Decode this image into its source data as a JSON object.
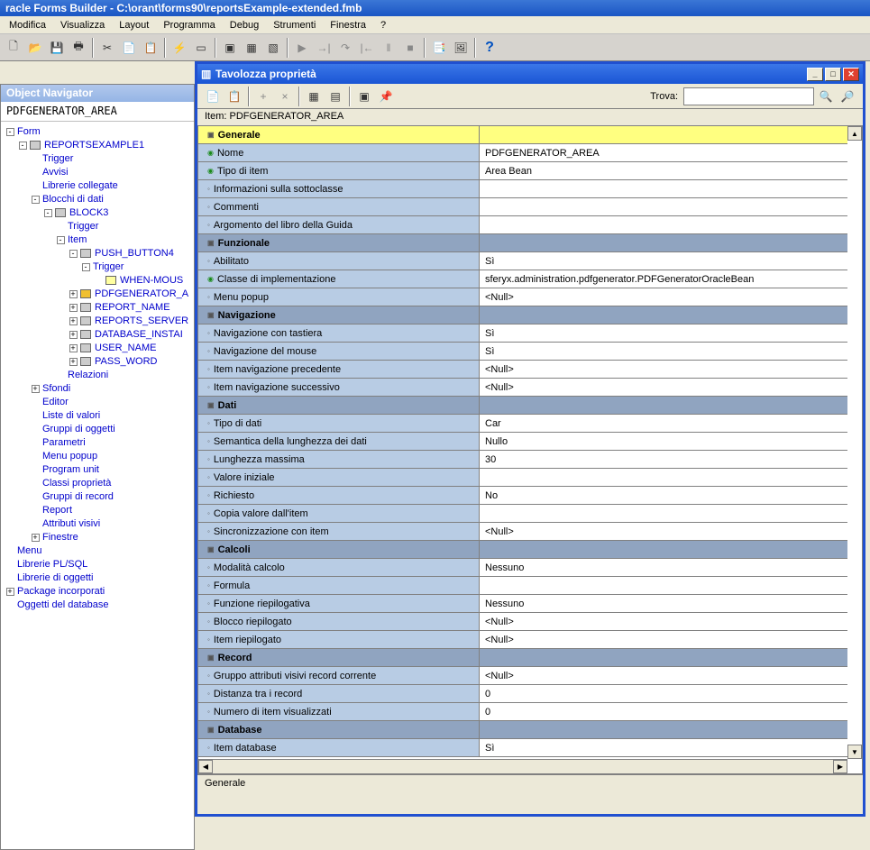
{
  "app_title": "racle Forms Builder - C:\\orant\\forms90\\reportsExample-extended.fmb",
  "menu": [
    "Modifica",
    "Visualizza",
    "Layout",
    "Programma",
    "Debug",
    "Strumenti",
    "Finestra",
    "?"
  ],
  "obj_nav": {
    "title": "Object Navigator",
    "current": "PDFGENERATOR_AREA",
    "tree": [
      {
        "indent": 0,
        "exp": "−",
        "glyph": "",
        "text": "Form"
      },
      {
        "indent": 1,
        "exp": "−",
        "glyph": "form",
        "text": "REPORTSEXAMPLE1"
      },
      {
        "indent": 2,
        "exp": "",
        "glyph": "",
        "text": "Trigger"
      },
      {
        "indent": 2,
        "exp": "",
        "glyph": "",
        "text": "Avvisi"
      },
      {
        "indent": 2,
        "exp": "",
        "glyph": "",
        "text": "Librerie collegate"
      },
      {
        "indent": 2,
        "exp": "−",
        "glyph": "",
        "text": "Blocchi di dati"
      },
      {
        "indent": 3,
        "exp": "−",
        "glyph": "block",
        "text": "BLOCK3"
      },
      {
        "indent": 4,
        "exp": "",
        "glyph": "",
        "text": "Trigger"
      },
      {
        "indent": 4,
        "exp": "−",
        "glyph": "",
        "text": "Item"
      },
      {
        "indent": 5,
        "exp": "−",
        "glyph": "item",
        "text": "PUSH_BUTTON4"
      },
      {
        "indent": 6,
        "exp": "−",
        "glyph": "",
        "text": "Trigger"
      },
      {
        "indent": 7,
        "exp": "",
        "glyph": "trig",
        "text": "WHEN-MOUS"
      },
      {
        "indent": 5,
        "exp": "+",
        "glyph": "sel",
        "text": "PDFGENERATOR_A"
      },
      {
        "indent": 5,
        "exp": "+",
        "glyph": "item",
        "text": "REPORT_NAME"
      },
      {
        "indent": 5,
        "exp": "+",
        "glyph": "item",
        "text": "REPORTS_SERVER"
      },
      {
        "indent": 5,
        "exp": "+",
        "glyph": "item",
        "text": "DATABASE_INSTAI"
      },
      {
        "indent": 5,
        "exp": "+",
        "glyph": "item",
        "text": "USER_NAME"
      },
      {
        "indent": 5,
        "exp": "+",
        "glyph": "item",
        "text": "PASS_WORD"
      },
      {
        "indent": 4,
        "exp": "",
        "glyph": "",
        "text": "Relazioni"
      },
      {
        "indent": 2,
        "exp": "+",
        "glyph": "",
        "text": "Sfondi"
      },
      {
        "indent": 2,
        "exp": "",
        "glyph": "",
        "text": "Editor"
      },
      {
        "indent": 2,
        "exp": "",
        "glyph": "",
        "text": "Liste di valori"
      },
      {
        "indent": 2,
        "exp": "",
        "glyph": "",
        "text": "Gruppi di oggetti"
      },
      {
        "indent": 2,
        "exp": "",
        "glyph": "",
        "text": "Parametri"
      },
      {
        "indent": 2,
        "exp": "",
        "glyph": "",
        "text": "Menu popup"
      },
      {
        "indent": 2,
        "exp": "",
        "glyph": "",
        "text": "Program unit"
      },
      {
        "indent": 2,
        "exp": "",
        "glyph": "",
        "text": "Classi proprietà"
      },
      {
        "indent": 2,
        "exp": "",
        "glyph": "",
        "text": "Gruppi di record"
      },
      {
        "indent": 2,
        "exp": "",
        "glyph": "",
        "text": "Report"
      },
      {
        "indent": 2,
        "exp": "",
        "glyph": "",
        "text": "Attributi visivi"
      },
      {
        "indent": 2,
        "exp": "+",
        "glyph": "",
        "text": "Finestre"
      },
      {
        "indent": 0,
        "exp": "",
        "glyph": "",
        "text": "Menu"
      },
      {
        "indent": 0,
        "exp": "",
        "glyph": "",
        "text": "Librerie PL/SQL"
      },
      {
        "indent": 0,
        "exp": "",
        "glyph": "",
        "text": "Librerie di oggetti"
      },
      {
        "indent": 0,
        "exp": "+",
        "glyph": "",
        "text": "Package incorporati"
      },
      {
        "indent": 0,
        "exp": "",
        "glyph": "",
        "text": "Oggetti del database"
      }
    ]
  },
  "prop": {
    "title": "Tavolozza proprietà",
    "find_label": "Trova:",
    "find_value": "",
    "item_label": "Item: PDFGENERATOR_AREA",
    "status": "Generale",
    "rows": [
      {
        "type": "section-yellow",
        "name": "Generale"
      },
      {
        "type": "prop",
        "changed": true,
        "name": "Nome",
        "value": "PDFGENERATOR_AREA"
      },
      {
        "type": "prop",
        "changed": true,
        "name": "Tipo di item",
        "value": "Area Bean"
      },
      {
        "type": "prop",
        "name": "Informazioni sulla sottoclasse",
        "value": ""
      },
      {
        "type": "prop",
        "name": "Commenti",
        "value": ""
      },
      {
        "type": "prop",
        "name": "Argomento del libro della Guida",
        "value": ""
      },
      {
        "type": "section",
        "name": "Funzionale"
      },
      {
        "type": "prop",
        "name": "Abilitato",
        "value": "Sì"
      },
      {
        "type": "prop",
        "changed": true,
        "name": "Classe di implementazione",
        "value": "sferyx.administration.pdfgenerator.PDFGeneratorOracleBean"
      },
      {
        "type": "prop",
        "name": "Menu popup",
        "value": "<Null>"
      },
      {
        "type": "section",
        "name": "Navigazione"
      },
      {
        "type": "prop",
        "name": "Navigazione con tastiera",
        "value": "Sì"
      },
      {
        "type": "prop",
        "name": "Navigazione del mouse",
        "value": "Sì"
      },
      {
        "type": "prop",
        "name": "Item navigazione precedente",
        "value": "<Null>"
      },
      {
        "type": "prop",
        "name": "Item navigazione successivo",
        "value": "<Null>"
      },
      {
        "type": "section",
        "name": "Dati"
      },
      {
        "type": "prop",
        "name": "Tipo di dati",
        "value": "Car"
      },
      {
        "type": "prop",
        "name": "Semantica della lunghezza dei dati",
        "value": "Nullo"
      },
      {
        "type": "prop",
        "name": "Lunghezza massima",
        "value": "30"
      },
      {
        "type": "prop",
        "name": "Valore iniziale",
        "value": ""
      },
      {
        "type": "prop",
        "name": "Richiesto",
        "value": "No"
      },
      {
        "type": "prop",
        "name": "Copia valore dall'item",
        "value": ""
      },
      {
        "type": "prop",
        "name": "Sincronizzazione con item",
        "value": "<Null>"
      },
      {
        "type": "section",
        "name": "Calcoli"
      },
      {
        "type": "prop",
        "name": "Modalità calcolo",
        "value": "Nessuno"
      },
      {
        "type": "prop",
        "name": "Formula",
        "value": ""
      },
      {
        "type": "prop",
        "name": "Funzione riepilogativa",
        "value": "Nessuno"
      },
      {
        "type": "prop",
        "name": "Blocco riepilogato",
        "value": "<Null>"
      },
      {
        "type": "prop",
        "name": "Item riepilogato",
        "value": "<Null>"
      },
      {
        "type": "section",
        "name": "Record"
      },
      {
        "type": "prop",
        "name": "Gruppo attributi visivi record corrente",
        "value": "<Null>"
      },
      {
        "type": "prop",
        "name": "Distanza tra i record",
        "value": "0"
      },
      {
        "type": "prop",
        "name": "Numero di item visualizzati",
        "value": "0"
      },
      {
        "type": "section",
        "name": "Database"
      },
      {
        "type": "prop",
        "name": "Item database",
        "value": "Sì"
      }
    ]
  }
}
